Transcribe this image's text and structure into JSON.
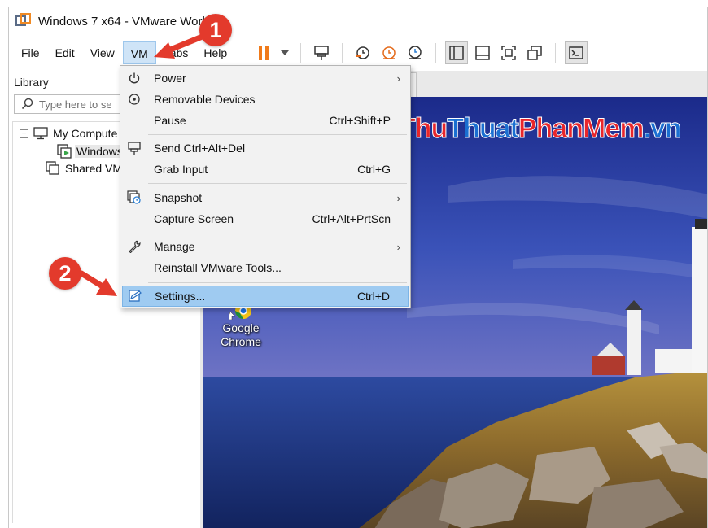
{
  "window": {
    "title": "Windows 7 x64 - VMware Works"
  },
  "menubar": {
    "items": [
      {
        "label": "File"
      },
      {
        "label": "Edit"
      },
      {
        "label": "View"
      },
      {
        "label": "VM"
      },
      {
        "label": "Tabs"
      },
      {
        "label": "Help"
      }
    ],
    "active": "VM"
  },
  "toolbar": {
    "icons": [
      "pause-icon",
      "dropdown-arrow-icon",
      "send-ctrl-alt-del-icon",
      "snapshot-take-icon",
      "snapshot-revert-icon",
      "snapshot-manager-icon",
      "show-library-icon",
      "thumbnail-bar-icon",
      "full-screen-icon",
      "unity-icon",
      "console-view-icon"
    ],
    "accent_color": "#f07a1a"
  },
  "sidebar": {
    "label": "Library",
    "search_placeholder": "Type here to se",
    "tree": [
      {
        "label": "My Compute",
        "expander": "−"
      },
      {
        "label": "Windows"
      },
      {
        "label": "Shared VMs"
      }
    ]
  },
  "desktop": {
    "watermark": {
      "part1": "Thu",
      "part2": "Thuat",
      "part3": "PhanMem",
      "part4": ".vn"
    },
    "icon_line1": "Google",
    "icon_line2": "Chrome"
  },
  "vm_menu": {
    "groups": [
      [
        {
          "label": "Power",
          "shortcut": "",
          "submenu": true,
          "icon": "power-icon"
        },
        {
          "label": "Removable Devices",
          "shortcut": "",
          "submenu": false,
          "icon": "removable-devices-icon"
        },
        {
          "label": "Pause",
          "shortcut": "Ctrl+Shift+P",
          "submenu": false,
          "icon": ""
        }
      ],
      [
        {
          "label": "Send Ctrl+Alt+Del",
          "shortcut": "",
          "submenu": false,
          "icon": "send-keys-icon"
        },
        {
          "label": "Grab Input",
          "shortcut": "Ctrl+G",
          "submenu": false,
          "icon": ""
        }
      ],
      [
        {
          "label": "Snapshot",
          "shortcut": "",
          "submenu": true,
          "icon": "snapshot-icon"
        },
        {
          "label": "Capture Screen",
          "shortcut": "Ctrl+Alt+PrtScn",
          "submenu": false,
          "icon": ""
        }
      ],
      [
        {
          "label": "Manage",
          "shortcut": "",
          "submenu": true,
          "icon": "wrench-icon"
        },
        {
          "label": "Reinstall VMware Tools...",
          "shortcut": "",
          "submenu": false,
          "icon": ""
        }
      ],
      [
        {
          "label": "Settings...",
          "shortcut": "Ctrl+D",
          "submenu": false,
          "icon": "settings-icon",
          "highlighted": true
        }
      ]
    ],
    "submenu_arrow": "›"
  },
  "annotations": {
    "step1": "1",
    "step2": "2",
    "color": "#e33a2c"
  }
}
